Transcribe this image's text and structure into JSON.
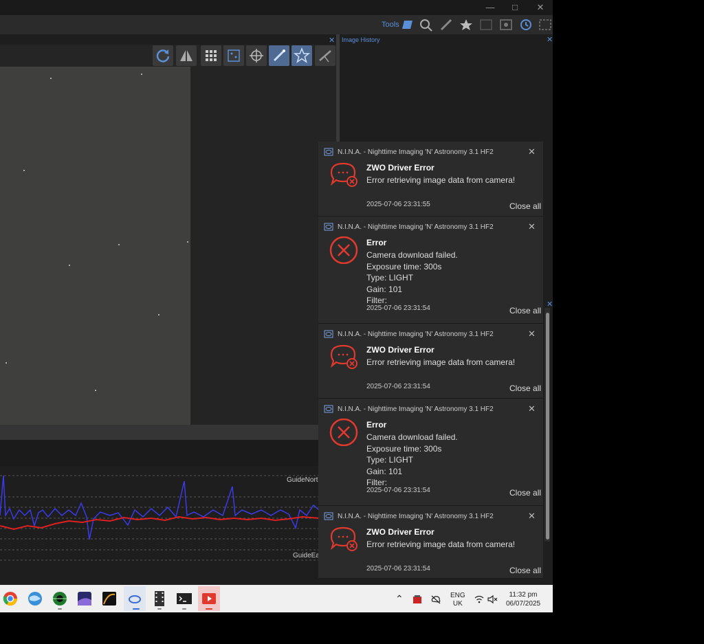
{
  "window": {
    "tools_label": "Tools",
    "image_history_title": "Image History"
  },
  "graph": {
    "label_north": "GuideNort",
    "label_east": "GuideEas"
  },
  "notifications": [
    {
      "app": "N.I.N.A. - Nighttime Imaging 'N' Astronomy 3.1 HF2",
      "icon": "speech-error-icon",
      "title": "ZWO Driver Error",
      "lines": [
        "Error retrieving image data from camera!"
      ],
      "time": "2025-07-06 23:31:55",
      "close_all": "Close all"
    },
    {
      "app": "N.I.N.A. - Nighttime Imaging 'N' Astronomy 3.1 HF2",
      "icon": "circle-x-icon",
      "title": "Error",
      "lines": [
        "Camera download failed.",
        "Exposure time: 300s",
        "Type: LIGHT",
        "Gain: 101",
        "Filter:"
      ],
      "time": "2025-07-06 23:31:54",
      "close_all": "Close all"
    },
    {
      "app": "N.I.N.A. - Nighttime Imaging 'N' Astronomy 3.1 HF2",
      "icon": "speech-error-icon",
      "title": "ZWO Driver Error",
      "lines": [
        "Error retrieving image data from camera!"
      ],
      "time": "2025-07-06 23:31:54",
      "close_all": "Close all"
    },
    {
      "app": "N.I.N.A. - Nighttime Imaging 'N' Astronomy 3.1 HF2",
      "icon": "circle-x-icon",
      "title": "Error",
      "lines": [
        "Camera download failed.",
        "Exposure time: 300s",
        "Type: LIGHT",
        "Gain: 101",
        "Filter:"
      ],
      "time": "2025-07-06 23:31:54",
      "close_all": "Close all"
    },
    {
      "app": "N.I.N.A. - Nighttime Imaging 'N' Astronomy 3.1 HF2",
      "icon": "speech-error-icon",
      "title": "ZWO Driver Error",
      "lines": [
        "Error retrieving image data from camera!"
      ],
      "time": "2025-07-06 23:31:54",
      "close_all": "Close all"
    }
  ],
  "taskbar": {
    "apps": [
      "chrome-icon",
      "globe-app-icon",
      "green-app-icon",
      "astro-app-icon",
      "curve-app-icon",
      "nina-app-icon",
      "film-app-icon",
      "terminal-icon",
      "red-app-icon"
    ],
    "lang_top": "ENG",
    "lang_bottom": "UK",
    "time": "11:32 pm",
    "date": "06/07/2025"
  },
  "colors": {
    "accent": "#5b8fd8",
    "error_red": "#e03a2f",
    "guide_ra": "#3a3ae8",
    "guide_dec": "#e02020"
  }
}
